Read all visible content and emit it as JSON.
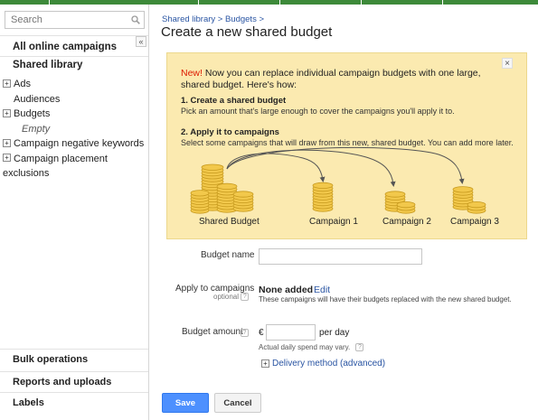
{
  "sidebar": {
    "search_placeholder": "Search",
    "all_campaigns": "All online campaigns",
    "collapse_glyph": "«",
    "shared_library": "Shared library",
    "tree": [
      {
        "label": "Ads",
        "expandable": true
      },
      {
        "label": "Audiences",
        "expandable": false
      },
      {
        "label": "Budgets",
        "expandable": true
      },
      {
        "label": "Empty",
        "expandable": false,
        "empty": true
      },
      {
        "label": "Campaign negative keywords",
        "expandable": true
      },
      {
        "label": "Campaign placement exclusions",
        "expandable": true
      }
    ],
    "bottom": [
      "Bulk operations",
      "Reports and uploads",
      "Labels"
    ]
  },
  "breadcrumb": "Shared library > Budgets >",
  "title": "Create a new shared budget",
  "info": {
    "new_tag": "New!",
    "intro": " Now you can replace individual campaign budgets with one large, shared budget. Here's how:",
    "step1_title": "1. Create a shared budget",
    "step1_text": "Pick an amount that's large enough to cover the campaigns you'll apply it to.",
    "step2_title": "2. Apply it to campaigns",
    "step2_text": "Select some campaigns that will draw from this new, shared budget. You can add more later.",
    "close_glyph": "×",
    "illustration": {
      "source": "Shared Budget",
      "targets": [
        "Campaign 1",
        "Campaign 2",
        "Campaign 3"
      ],
      "coin_color": "#f2c84b"
    }
  },
  "form": {
    "budget_name_label": "Budget name",
    "budget_name_value": "",
    "apply_label": "Apply to campaigns",
    "optional": "optional",
    "help_glyph": "?",
    "none_added": "None added",
    "edit": "Edit",
    "apply_note": "These campaigns will have their budgets replaced with the new shared budget.",
    "amount_label": "Budget amount",
    "currency": "€",
    "amount_value": "",
    "per_day": "per day",
    "spend_note": "Actual daily spend may vary.",
    "delivery": "Delivery method (advanced)"
  },
  "buttons": {
    "save": "Save",
    "cancel": "Cancel"
  },
  "colors": {
    "accent": "#4d90fe",
    "link": "#2a55a3",
    "info_bg": "#fbeab0",
    "new": "#dd1a00",
    "top_bar": "#3d8a3a"
  }
}
